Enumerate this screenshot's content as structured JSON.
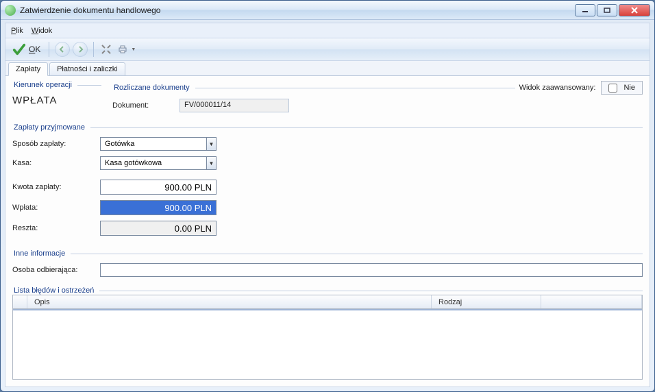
{
  "window": {
    "title": "Zatwierdzenie dokumentu handlowego"
  },
  "menu": {
    "plik": "Plik",
    "widok": "Widok"
  },
  "toolbar": {
    "ok_label": "OK"
  },
  "tabs": {
    "zaplaty": "Zapłaty",
    "platnosci": "Płatności i zaliczki"
  },
  "groups": {
    "kierunek_title": "Kierunek operacji",
    "rozliczane_title": "Rozliczane dokumenty",
    "zaplaty_title": "Zapłaty przyjmowane",
    "inne_title": "Inne informacje",
    "lista_title": "Lista błędów i ostrzeżeń"
  },
  "kierunek": {
    "operation": "WPŁATA"
  },
  "rozliczane": {
    "dokument_label": "Dokument:",
    "dokument_value": "FV/000011/14"
  },
  "advanced": {
    "label": "Widok zaawansowany:",
    "value_text": "Nie",
    "checked": false
  },
  "zaplaty": {
    "sposob_label": "Sposób zapłaty:",
    "sposob_value": "Gotówka",
    "kasa_label": "Kasa:",
    "kasa_value": "Kasa gotówkowa",
    "kwota_label": "Kwota zapłaty:",
    "kwota_value": "900.00 PLN",
    "wplata_label": "Wpłata:",
    "wplata_value": "900.00 PLN",
    "reszta_label": "Reszta:",
    "reszta_value": "0.00 PLN"
  },
  "inne": {
    "osoba_label": "Osoba odbierająca:",
    "osoba_value": ""
  },
  "grid": {
    "col_opis": "Opis",
    "col_rodzaj": "Rodzaj"
  }
}
